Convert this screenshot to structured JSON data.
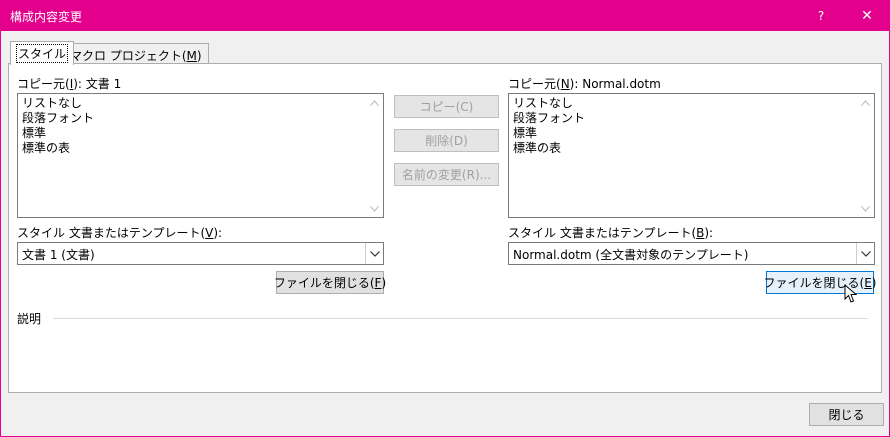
{
  "window": {
    "title": "構成内容変更",
    "help": "?",
    "close": "✕"
  },
  "tabs": [
    {
      "label": "スタイル",
      "active": true
    },
    {
      "label_pre": "マクロ プロジェクト(",
      "key": "M",
      "label_post": ")",
      "active": false
    }
  ],
  "left": {
    "copy_from_pre": "コピー元(",
    "copy_from_key": "I",
    "copy_from_post": "): 文書 1",
    "items": [
      "リストなし",
      "段落フォント",
      "標準",
      "標準の表"
    ],
    "source_label_pre": "スタイル 文書またはテンプレート(",
    "source_label_key": "V",
    "source_label_post": "):",
    "source_value": "文書 1 (文書)",
    "close_file_pre": "ファイルを閉じる(",
    "close_file_key": "F",
    "close_file_post": ")"
  },
  "right": {
    "copy_from_pre": "コピー元(",
    "copy_from_key": "N",
    "copy_from_post": "): Normal.dotm",
    "items": [
      "リストなし",
      "段落フォント",
      "標準",
      "標準の表"
    ],
    "source_label_pre": "スタイル 文書またはテンプレート(",
    "source_label_key": "B",
    "source_label_post": "):",
    "source_value": "Normal.dotm (全文書対象のテンプレート)",
    "close_file_pre": "ファイルを閉じる(",
    "close_file_key": "E",
    "close_file_post": ")"
  },
  "middle": {
    "copy": "コピー(C)",
    "delete": "削除(D)",
    "rename": "名前の変更(R)..."
  },
  "description": {
    "label": "説明"
  },
  "footer": {
    "close": "閉じる"
  }
}
